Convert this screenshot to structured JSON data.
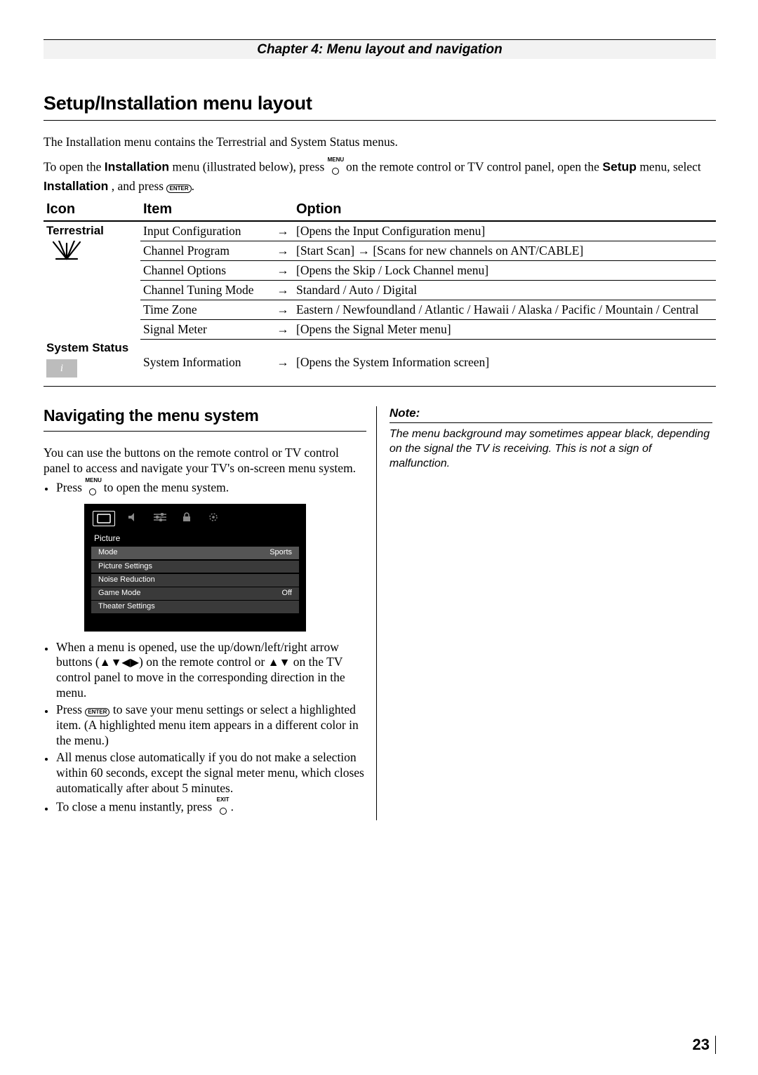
{
  "header": {
    "chapter_bar": "Chapter 4: Menu layout and navigation"
  },
  "section1": {
    "title": "Setup/Installation menu layout",
    "para1": "The Installation menu contains the Terrestrial and System Status menus.",
    "para2a": "To open the ",
    "para2b_bold": "Installation",
    "para2c": " menu (illustrated below), press ",
    "menu_label": "MENU",
    "para2d": " on the remote control or TV control panel, open the ",
    "para2e_bold": "Setup",
    "para2f": " menu, select ",
    "para2g_bold": "Installation",
    "para2h": ", and press ",
    "enter_label": "ENTER",
    "para2i": "."
  },
  "table": {
    "headers": {
      "icon": "Icon",
      "item": "Item",
      "option": "Option"
    },
    "arrow": "→",
    "groups": [
      {
        "label": "Terrestrial",
        "rows": [
          {
            "item": "Input Configuration",
            "option": "[Opens the Input Configuration menu]"
          },
          {
            "item": "Channel Program",
            "option": "[Start Scan] → [Scans for new channels on ANT/CABLE]"
          },
          {
            "item": "Channel Options",
            "option": "[Opens the Skip / Lock Channel menu]"
          },
          {
            "item": "Channel Tuning Mode",
            "option": "Standard / Auto / Digital"
          },
          {
            "item": "Time Zone",
            "option": "Eastern / Newfoundland / Atlantic / Hawaii / Alaska / Pacific / Mountain / Central"
          },
          {
            "item": "Signal Meter",
            "option": "[Opens the Signal Meter menu]"
          }
        ]
      },
      {
        "label": "System Status",
        "rows": [
          {
            "item": "System Information",
            "option": "[Opens the System Information screen]"
          }
        ]
      }
    ]
  },
  "section2": {
    "title": "Navigating the menu system",
    "para": "You can use the buttons on the remote control or TV control panel to access and navigate your TV's on-screen menu system.",
    "bullets": {
      "b1a": "Press ",
      "b1_menu": "MENU",
      "b1b": " to open the menu system.",
      "b2a": "When a menu is opened, use the up/down/left/right arrow buttons (",
      "b2_arrows1": "▲▼◀▶",
      "b2b": ") on the remote control or ",
      "b2_arrows2": "▲▼",
      "b2c": " on the TV control panel to move in the corresponding direction in the menu.",
      "b3a": "Press ",
      "b3_enter": "ENTER",
      "b3b": " to save your menu settings or select a highlighted item. (A highlighted menu item appears in a different color in the menu.)",
      "b4": "All menus close automatically if you do not make a selection within 60 seconds, except the signal meter menu, which closes automatically after about 5 minutes.",
      "b5a": "To close a menu instantly, press ",
      "b5_exit": "EXIT",
      "b5b": "."
    }
  },
  "osd": {
    "title": "Picture",
    "rows": [
      {
        "label": "Mode",
        "value": "Sports"
      },
      {
        "label": "Picture Settings",
        "value": ""
      },
      {
        "label": "Noise Reduction",
        "value": ""
      },
      {
        "label": "Game Mode",
        "value": "Off"
      },
      {
        "label": "Theater Settings",
        "value": ""
      }
    ]
  },
  "note": {
    "head": "Note:",
    "body": "The menu background may sometimes appear black, depending on the signal the TV is receiving. This is not a sign of malfunction."
  },
  "footer": {
    "page_number": "23"
  }
}
